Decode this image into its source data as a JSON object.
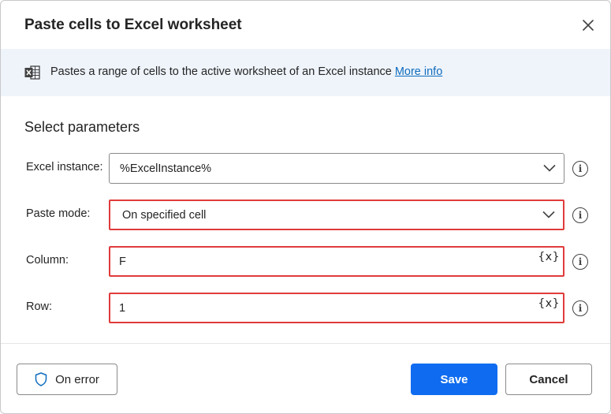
{
  "dialog": {
    "title": "Paste cells to Excel worksheet",
    "close_icon": "close-icon"
  },
  "info": {
    "icon": "excel-icon",
    "text": "Pastes a range of cells to the active worksheet of an Excel instance",
    "link": "More info"
  },
  "section": {
    "title": "Select parameters"
  },
  "fields": {
    "excel_instance": {
      "label": "Excel instance:",
      "value": "%ExcelInstance%"
    },
    "paste_mode": {
      "label": "Paste mode:",
      "value": "On specified cell"
    },
    "column": {
      "label": "Column:",
      "value": "F",
      "var_label": "{x}"
    },
    "row": {
      "label": "Row:",
      "value": "1",
      "var_label": "{x}"
    }
  },
  "info_button_glyph": "i",
  "footer": {
    "on_error_label": "On error",
    "save_label": "Save",
    "cancel_label": "Cancel"
  },
  "colors": {
    "accent": "#0f6cf0",
    "highlight": "#e03b3b",
    "banner": "#eff4fb",
    "link": "#0f6cbd"
  }
}
